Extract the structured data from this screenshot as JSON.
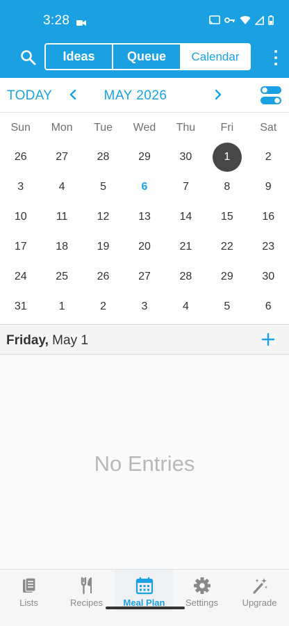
{
  "status": {
    "time": "3:28"
  },
  "appbar": {
    "tabs": {
      "ideas": "Ideas",
      "queue": "Queue",
      "calendar": "Calendar"
    }
  },
  "calendar": {
    "today_label": "TODAY",
    "month_label": "MAY 2026",
    "weekdays": [
      "Sun",
      "Mon",
      "Tue",
      "Wed",
      "Thu",
      "Fri",
      "Sat"
    ],
    "weeks": [
      [
        "26",
        "27",
        "28",
        "29",
        "30",
        "1",
        "2"
      ],
      [
        "3",
        "4",
        "5",
        "6",
        "7",
        "8",
        "9"
      ],
      [
        "10",
        "11",
        "12",
        "13",
        "14",
        "15",
        "16"
      ],
      [
        "17",
        "18",
        "19",
        "20",
        "21",
        "22",
        "23"
      ],
      [
        "24",
        "25",
        "26",
        "27",
        "28",
        "29",
        "30"
      ],
      [
        "31",
        "1",
        "2",
        "3",
        "4",
        "5",
        "6"
      ]
    ],
    "selected_cell": [
      0,
      5
    ],
    "today_cell": [
      1,
      3
    ]
  },
  "day_header": {
    "weekday": "Friday,",
    "date": "May 1"
  },
  "entries": {
    "empty_text": "No Entries"
  },
  "bottom_nav": [
    {
      "label": "Lists",
      "icon": "lists-icon"
    },
    {
      "label": "Recipes",
      "icon": "fork-knife-icon"
    },
    {
      "label": "Meal Plan",
      "icon": "calendar-icon"
    },
    {
      "label": "Settings",
      "icon": "gear-icon"
    },
    {
      "label": "Upgrade",
      "icon": "magic-wand-icon"
    }
  ],
  "colors": {
    "accent": "#1ba1e2",
    "selected_day": "#474747"
  }
}
